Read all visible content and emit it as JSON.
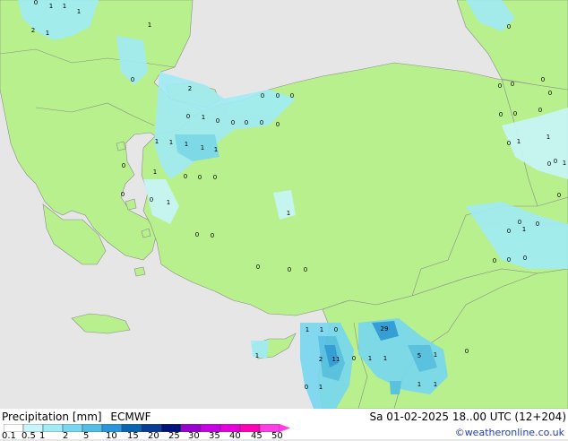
{
  "legend": {
    "title": "Precipitation [mm]",
    "model": "ECMWF",
    "scale_labels": [
      "0.1",
      "0.5",
      "1",
      "2",
      "5",
      "10",
      "15",
      "20",
      "25",
      "30",
      "35",
      "40",
      "45",
      "50"
    ],
    "scale_colors": [
      "#ffffff",
      "#c8f5fa",
      "#a0ebf5",
      "#78d7f0",
      "#50bee6",
      "#2896dc",
      "#0a64b4",
      "#0a3c96",
      "#00127d",
      "#9b00d2",
      "#c800e6",
      "#e600dc",
      "#ff00b4",
      "#ff3ce6"
    ]
  },
  "timestamp": "Sa 01-02-2025 18..00 UTC (12+204)",
  "credit": "©weatheronline.co.uk",
  "colors": {
    "land": "#b7f08c",
    "sea": "#e6e6e6",
    "border": "#8c8c8c"
  },
  "map_values": [
    {
      "v": "1"
    },
    {
      "v": "1"
    },
    {
      "v": "1"
    },
    {
      "v": "2"
    },
    {
      "v": "1"
    },
    {
      "v": "1"
    },
    {
      "v": "0"
    },
    {
      "v": "0"
    },
    {
      "v": "2"
    },
    {
      "v": "0"
    },
    {
      "v": "0"
    },
    {
      "v": "0"
    },
    {
      "v": "0"
    },
    {
      "v": "0"
    },
    {
      "v": "0"
    },
    {
      "v": "1"
    },
    {
      "v": "0"
    },
    {
      "v": "0"
    },
    {
      "v": "0"
    },
    {
      "v": "0"
    },
    {
      "v": "0"
    },
    {
      "v": "0"
    },
    {
      "v": "1"
    },
    {
      "v": "1"
    },
    {
      "v": "1"
    },
    {
      "v": "1"
    },
    {
      "v": "1"
    },
    {
      "v": "1"
    },
    {
      "v": "1"
    },
    {
      "v": "0"
    },
    {
      "v": "0"
    },
    {
      "v": "0"
    },
    {
      "v": "0"
    },
    {
      "v": "0"
    },
    {
      "v": "1"
    },
    {
      "v": "0"
    },
    {
      "v": "0"
    },
    {
      "v": "0"
    },
    {
      "v": "1"
    },
    {
      "v": "0"
    },
    {
      "v": "0"
    },
    {
      "v": "0"
    },
    {
      "v": "0"
    },
    {
      "v": "0"
    },
    {
      "v": "0"
    },
    {
      "v": "0"
    },
    {
      "v": "0"
    },
    {
      "v": "1"
    },
    {
      "v": "0"
    },
    {
      "v": "1"
    },
    {
      "v": "0"
    },
    {
      "v": "0"
    },
    {
      "v": "1"
    },
    {
      "v": "0"
    },
    {
      "v": "0"
    },
    {
      "v": "0"
    },
    {
      "v": "0"
    },
    {
      "v": "0"
    },
    {
      "v": "0"
    },
    {
      "v": "1"
    },
    {
      "v": "1"
    },
    {
      "v": "0"
    },
    {
      "v": "29"
    },
    {
      "v": "1"
    },
    {
      "v": "2"
    },
    {
      "v": "11"
    },
    {
      "v": "0"
    },
    {
      "v": "1"
    },
    {
      "v": "1"
    },
    {
      "v": "5"
    },
    {
      "v": "1"
    },
    {
      "v": "0"
    },
    {
      "v": "1"
    },
    {
      "v": "1"
    },
    {
      "v": "0"
    },
    {
      "v": "1"
    },
    {
      "v": "0"
    }
  ]
}
